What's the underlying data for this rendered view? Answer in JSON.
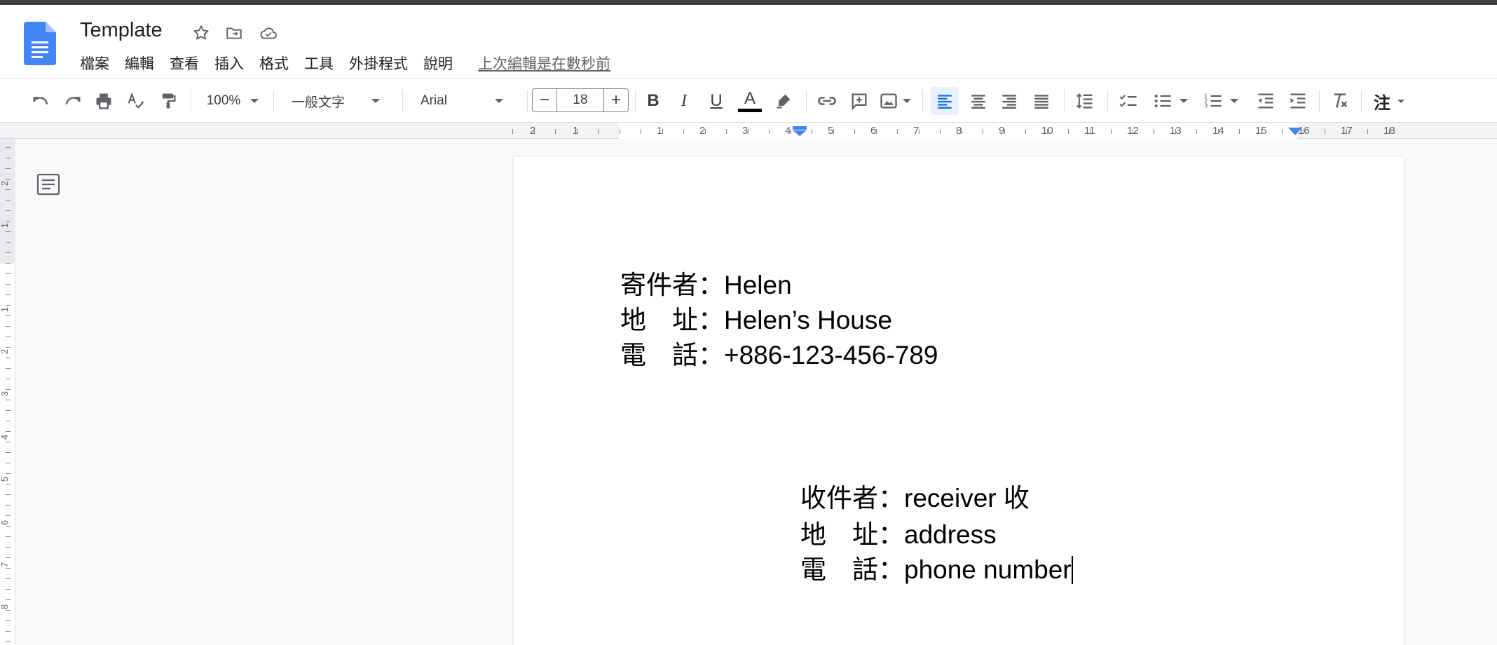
{
  "document": {
    "title": "Template",
    "last_edit": "上次編輯是在數秒前"
  },
  "menu": {
    "items": [
      "檔案",
      "編輯",
      "查看",
      "插入",
      "格式",
      "工具",
      "外掛程式",
      "說明"
    ]
  },
  "toolbar": {
    "zoom": "100%",
    "style": "一般文字",
    "font": "Arial",
    "font_size": "18",
    "decrease": "−",
    "increase": "+",
    "bold": "B",
    "italic": "I",
    "underline": "U",
    "text_color": "A",
    "input_tools": "注"
  },
  "ruler": {
    "h_labels": [
      "2",
      "1",
      "1",
      "2",
      "3",
      "4",
      "5",
      "6",
      "7",
      "8",
      "9",
      "10",
      "11",
      "12",
      "13",
      "14",
      "15",
      "16",
      "17",
      "18"
    ],
    "v_labels": [
      "2",
      "1",
      "1",
      "2",
      "3",
      "4",
      "5",
      "6",
      "7",
      "8"
    ]
  },
  "content": {
    "sender": [
      {
        "label": "寄件者：",
        "value": "Helen"
      },
      {
        "label": "地　址：",
        "value": "Helen’s House"
      },
      {
        "label": "電　話：",
        "value": "+886-123-456-789"
      }
    ],
    "receiver": [
      {
        "label": "收件者：",
        "value": "receiver 收"
      },
      {
        "label": "地　址：",
        "value": "address"
      },
      {
        "label": "電　話：",
        "value": "phone number"
      }
    ]
  },
  "colors": {
    "docs_blue": "#4285f4",
    "accent": "#1a73e8",
    "highlight": "#e8f0fe"
  }
}
